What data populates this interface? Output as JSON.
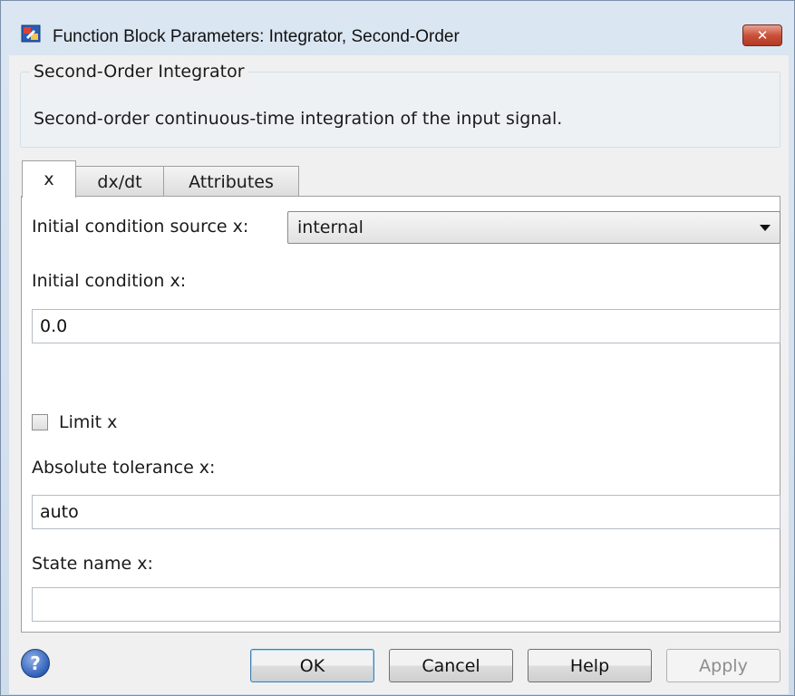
{
  "window": {
    "title": "Function Block Parameters: Integrator, Second-Order",
    "close_label": "✕",
    "icon": "simulink-block-icon"
  },
  "group": {
    "title": "Second-Order Integrator",
    "description": "Second-order continuous-time integration of the input signal."
  },
  "tabs": [
    {
      "label": "x",
      "active": true
    },
    {
      "label": "dx/dt",
      "active": false
    },
    {
      "label": "Attributes",
      "active": false
    }
  ],
  "form": {
    "ic_source_label": "Initial condition source x:",
    "ic_source_value": "internal",
    "ic_label": "Initial condition x:",
    "ic_value": "0.0",
    "limit_label": "Limit x",
    "limit_checked": false,
    "abs_tol_label": "Absolute tolerance x:",
    "abs_tol_value": "auto",
    "state_name_label": "State name x:",
    "state_name_value": ""
  },
  "buttons": {
    "help_icon": "?",
    "ok": "OK",
    "cancel": "Cancel",
    "help": "Help",
    "apply": "Apply"
  }
}
